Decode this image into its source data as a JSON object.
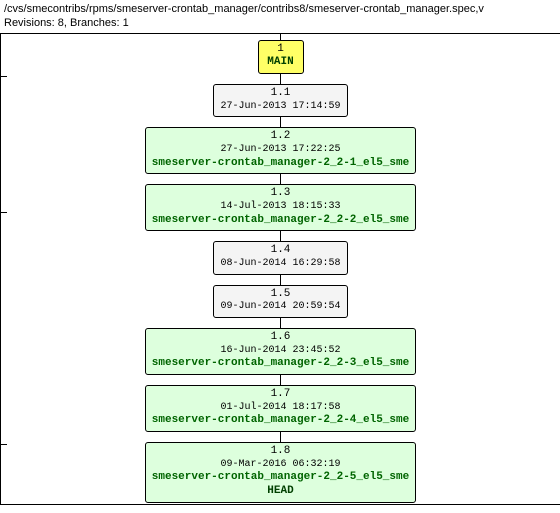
{
  "header": {
    "path": "/cvs/smecontribs/rpms/smeserver-crontab_manager/contribs8/smeserver-crontab_manager.spec,v",
    "summary": "Revisions: 8, Branches: 1"
  },
  "branch": {
    "rev": "1",
    "name": "MAIN"
  },
  "nodes": [
    {
      "rev": "1.1",
      "date": "27-Jun-2013 17:14:59",
      "tag": "",
      "tagged": false
    },
    {
      "rev": "1.2",
      "date": "27-Jun-2013 17:22:25",
      "tag": "smeserver-crontab_manager-2_2-1_el5_sme",
      "tagged": true
    },
    {
      "rev": "1.3",
      "date": "14-Jul-2013 18:15:33",
      "tag": "smeserver-crontab_manager-2_2-2_el5_sme",
      "tagged": true
    },
    {
      "rev": "1.4",
      "date": "08-Jun-2014 16:29:58",
      "tag": "",
      "tagged": false
    },
    {
      "rev": "1.5",
      "date": "09-Jun-2014 20:59:54",
      "tag": "",
      "tagged": false
    },
    {
      "rev": "1.6",
      "date": "16-Jun-2014 23:45:52",
      "tag": "smeserver-crontab_manager-2_2-3_el5_sme",
      "tagged": true
    },
    {
      "rev": "1.7",
      "date": "01-Jul-2014 18:17:58",
      "tag": "smeserver-crontab_manager-2_2-4_el5_sme",
      "tagged": true
    },
    {
      "rev": "1.8",
      "date": "09-Mar-2016 06:32:19",
      "tag": "smeserver-crontab_manager-2_2-5_el5_sme",
      "tagged": true,
      "head": "HEAD"
    }
  ]
}
